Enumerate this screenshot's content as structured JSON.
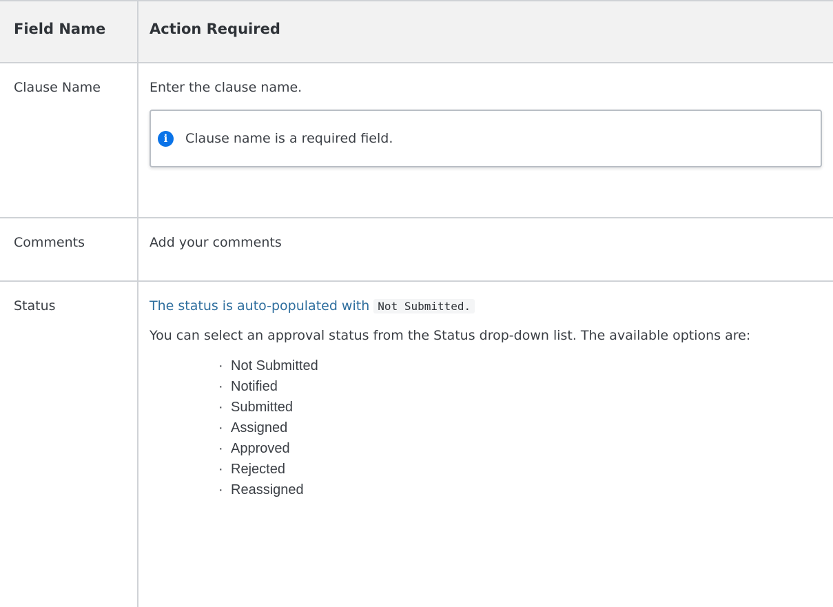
{
  "table": {
    "headers": [
      "Field Name",
      "Action Required"
    ],
    "rows": {
      "clause_name": {
        "field": "Clause Name",
        "action": "Enter the clause name.",
        "note": "Clause name is a required field.",
        "note_icon": "info-icon"
      },
      "comments": {
        "field": "Comments",
        "action": "Add your comments"
      },
      "status": {
        "field": "Status",
        "intro": "The status is auto-populated with",
        "code": "Not Submitted.",
        "description": "You can select an approval status from the Status drop-down list. The available options are:",
        "options": [
          "Not Submitted",
          "Notified",
          "Submitted",
          "Assigned",
          "Approved",
          "Rejected",
          "Reassigned"
        ]
      }
    }
  },
  "colors": {
    "info_icon": "#0a73e8",
    "status_intro_text": "#2e6e9e",
    "header_background": "#f2f2f2",
    "border": "#cfd2d6"
  }
}
